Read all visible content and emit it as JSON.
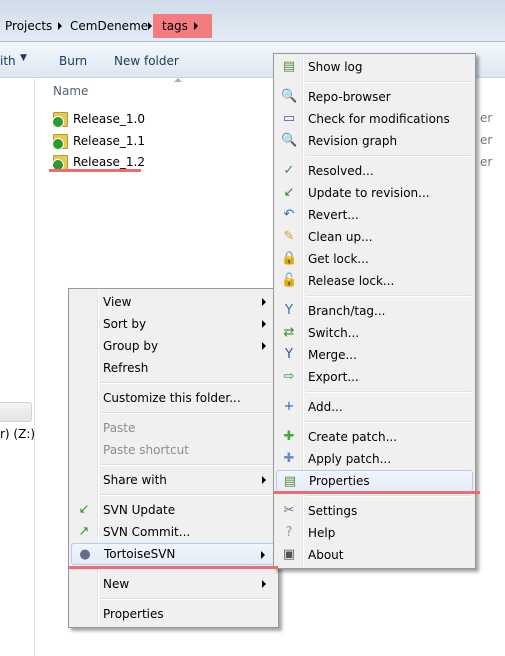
{
  "breadcrumb": [
    "Projects",
    "CemDeneme",
    "tags"
  ],
  "toolbar": {
    "share_label": "ith",
    "burn_label": "Burn",
    "new_folder_label": "New folder"
  },
  "columns": {
    "name": "Name"
  },
  "files": [
    "Release_1.0",
    "Release_1.1",
    "Release_1.2"
  ],
  "file_type_fragment": "er",
  "nav": {
    "drive_label": "r) (Z:)"
  },
  "colors": {
    "highlight_red": "#f47c80",
    "menu_bg": "#f0f0f0"
  },
  "context_menu": [
    {
      "label": "View",
      "submenu": true
    },
    {
      "label": "Sort by",
      "submenu": true
    },
    {
      "label": "Group by",
      "submenu": true
    },
    {
      "label": "Refresh"
    },
    {
      "sep": true
    },
    {
      "label": "Customize this folder..."
    },
    {
      "sep": true
    },
    {
      "label": "Paste",
      "disabled": true
    },
    {
      "label": "Paste shortcut",
      "disabled": true
    },
    {
      "sep": true
    },
    {
      "label": "Share with",
      "submenu": true
    },
    {
      "sep": true
    },
    {
      "label": "SVN Update",
      "icon": "svn-update-icon"
    },
    {
      "label": "SVN Commit...",
      "icon": "svn-commit-icon"
    },
    {
      "label": "TortoiseSVN",
      "icon": "tortoise-icon",
      "submenu": true,
      "highlighted": true
    },
    {
      "sep": true
    },
    {
      "label": "New",
      "submenu": true
    },
    {
      "sep": true
    },
    {
      "label": "Properties"
    }
  ],
  "tortoise_menu": [
    {
      "label": "Show log",
      "icon": "show-log-icon"
    },
    {
      "sep": true
    },
    {
      "label": "Repo-browser",
      "icon": "repo-browser-icon"
    },
    {
      "label": "Check for modifications",
      "icon": "check-modifications-icon"
    },
    {
      "label": "Revision graph",
      "icon": "revision-graph-icon"
    },
    {
      "sep": true
    },
    {
      "label": "Resolved...",
      "icon": "resolved-icon"
    },
    {
      "label": "Update to revision...",
      "icon": "update-revision-icon"
    },
    {
      "label": "Revert...",
      "icon": "revert-icon"
    },
    {
      "label": "Clean up...",
      "icon": "cleanup-icon"
    },
    {
      "label": "Get lock...",
      "icon": "lock-icon"
    },
    {
      "label": "Release lock...",
      "icon": "unlock-icon"
    },
    {
      "sep": true
    },
    {
      "label": "Branch/tag...",
      "icon": "branch-icon"
    },
    {
      "label": "Switch...",
      "icon": "switch-icon"
    },
    {
      "label": "Merge...",
      "icon": "merge-icon"
    },
    {
      "label": "Export...",
      "icon": "export-icon"
    },
    {
      "sep": true
    },
    {
      "label": "Add...",
      "icon": "add-icon"
    },
    {
      "sep": true
    },
    {
      "label": "Create patch...",
      "icon": "create-patch-icon"
    },
    {
      "label": "Apply patch...",
      "icon": "apply-patch-icon"
    },
    {
      "label": "Properties",
      "icon": "properties-icon",
      "highlighted": true
    },
    {
      "sep": true
    },
    {
      "label": "Settings",
      "icon": "settings-icon"
    },
    {
      "label": "Help",
      "icon": "help-icon"
    },
    {
      "label": "About",
      "icon": "about-icon"
    }
  ]
}
